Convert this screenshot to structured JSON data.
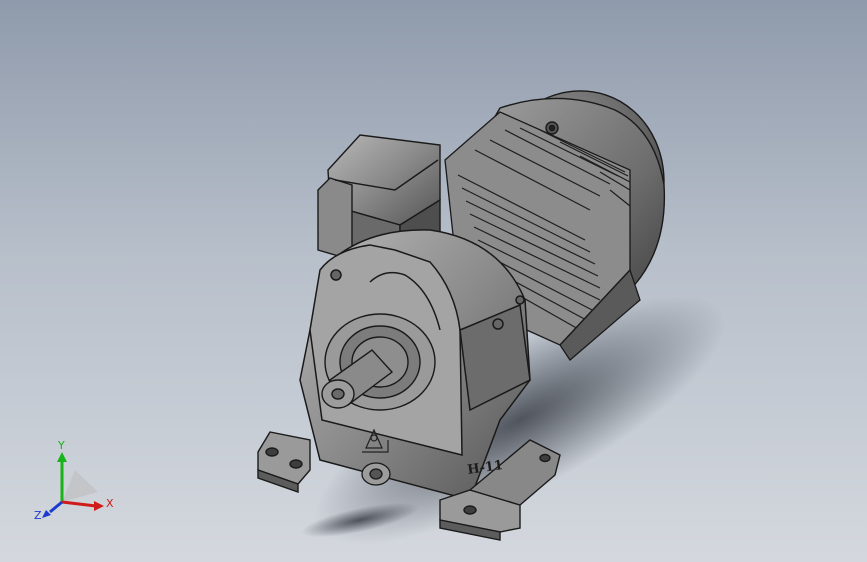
{
  "viewport": {
    "background_top": "#8f9aab",
    "background_bottom": "#d4d8de"
  },
  "model": {
    "name": "gear-motor",
    "body_color": "#7d7d7d",
    "edge_color": "#1a1a1a",
    "engraving": "H-11"
  },
  "triad": {
    "x_label": "X",
    "y_label": "Y",
    "z_label": "Z",
    "x_color": "#d11a1a",
    "y_color": "#18b318",
    "z_color": "#1a3bd1"
  }
}
